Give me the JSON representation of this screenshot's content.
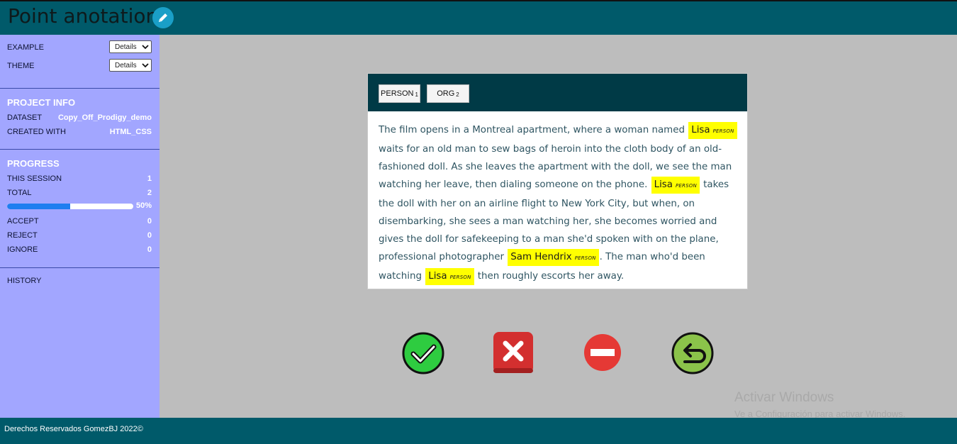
{
  "header": {
    "title": "Point anotation",
    "edit_icon": "pencil-icon"
  },
  "sidebar": {
    "example_label": "EXAMPLE",
    "example_select": "Details",
    "theme_label": "THEME",
    "theme_select": "Details",
    "project_info": {
      "heading": "PROJECT INFO",
      "dataset_label": "DATASET",
      "dataset_value": "Copy_Off_Prodigy_demo",
      "created_label": "CREATED WITH",
      "created_value": "HTML_CSS"
    },
    "progress": {
      "heading": "PROGRESS",
      "session_label": "THIS SESSION",
      "session_value": "1",
      "total_label": "TOTAL",
      "total_value": "2",
      "percent": 50,
      "percent_text": "50%",
      "accept_label": "ACCEPT",
      "accept_value": "0",
      "reject_label": "REJECT",
      "reject_value": "0",
      "ignore_label": "IGNORE",
      "ignore_value": "0"
    },
    "history_label": "HISTORY"
  },
  "labels": [
    {
      "name": "PERSON",
      "key": "1"
    },
    {
      "name": "ORG",
      "key": "2"
    }
  ],
  "text": {
    "t1": "The film opens in a Montreal apartment, where a woman named",
    "e1": "Lisa",
    "t2": "waits for an old man to sew bags of heroin into the cloth body of an old-fashioned doll. As she leaves the apartment with the doll, we see the man watching her leave, then dialing someone on the phone.",
    "e2": "Lisa",
    "t3": "takes the doll with her on an airline flight to New York City, but when, on disembarking, she sees a man watching her, she becomes worried and gives the doll for safekeeping to a man she'd spoken with on the plane, professional photographer",
    "e3": "Sam Hendrix",
    "t4": ". The man who'd been watching",
    "e4": "Lisa",
    "t5": "then roughly escorts her away.",
    "entity_label": "PERSON"
  },
  "actions": {
    "accept_icon": "check-icon",
    "reject_icon": "x-icon",
    "ignore_icon": "no-entry-icon",
    "undo_icon": "undo-icon",
    "accept_color": "#2ecc40",
    "reject_color": "#d32f2f",
    "ignore_color": "#e53935",
    "undo_color": "#8bc34a"
  },
  "footer": {
    "text": "Derechos Reservados GomezBJ 2022©"
  },
  "watermark": {
    "line1": "Activar Windows",
    "line2": "Ve a Configuración para activar Windows."
  },
  "colors": {
    "header_bg": "#005a6a",
    "sidebar_bg": "#a2a6ff",
    "highlight": "#ffff00",
    "card_head": "#003a46"
  }
}
